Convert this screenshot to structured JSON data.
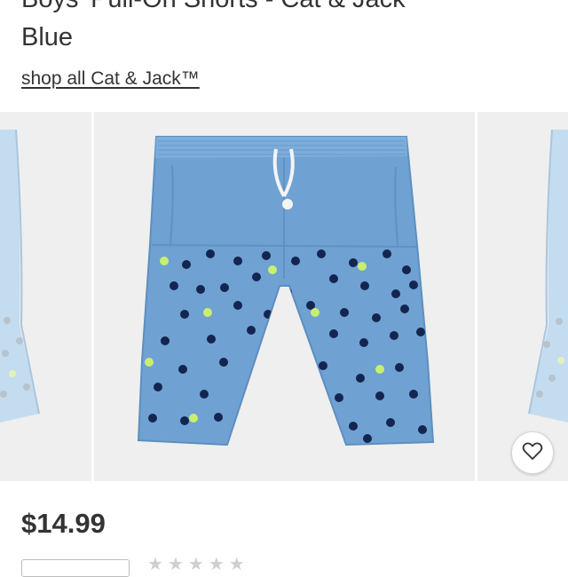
{
  "product": {
    "title_line1": "Boys' Pull-On Shorts - Cat & Jack™",
    "title_line2": "Blue",
    "shop_all_link": "shop all Cat & Jack™",
    "price": "$14.99",
    "rating_stars": 0
  },
  "icons": {
    "favorite": "heart-icon",
    "star": "star-icon"
  },
  "colors": {
    "image_background": "#efefef",
    "shorts_blue": "#6fa1d3",
    "dot_navy": "#14254f",
    "dot_lime": "#c8ef6f",
    "text": "#333333"
  }
}
